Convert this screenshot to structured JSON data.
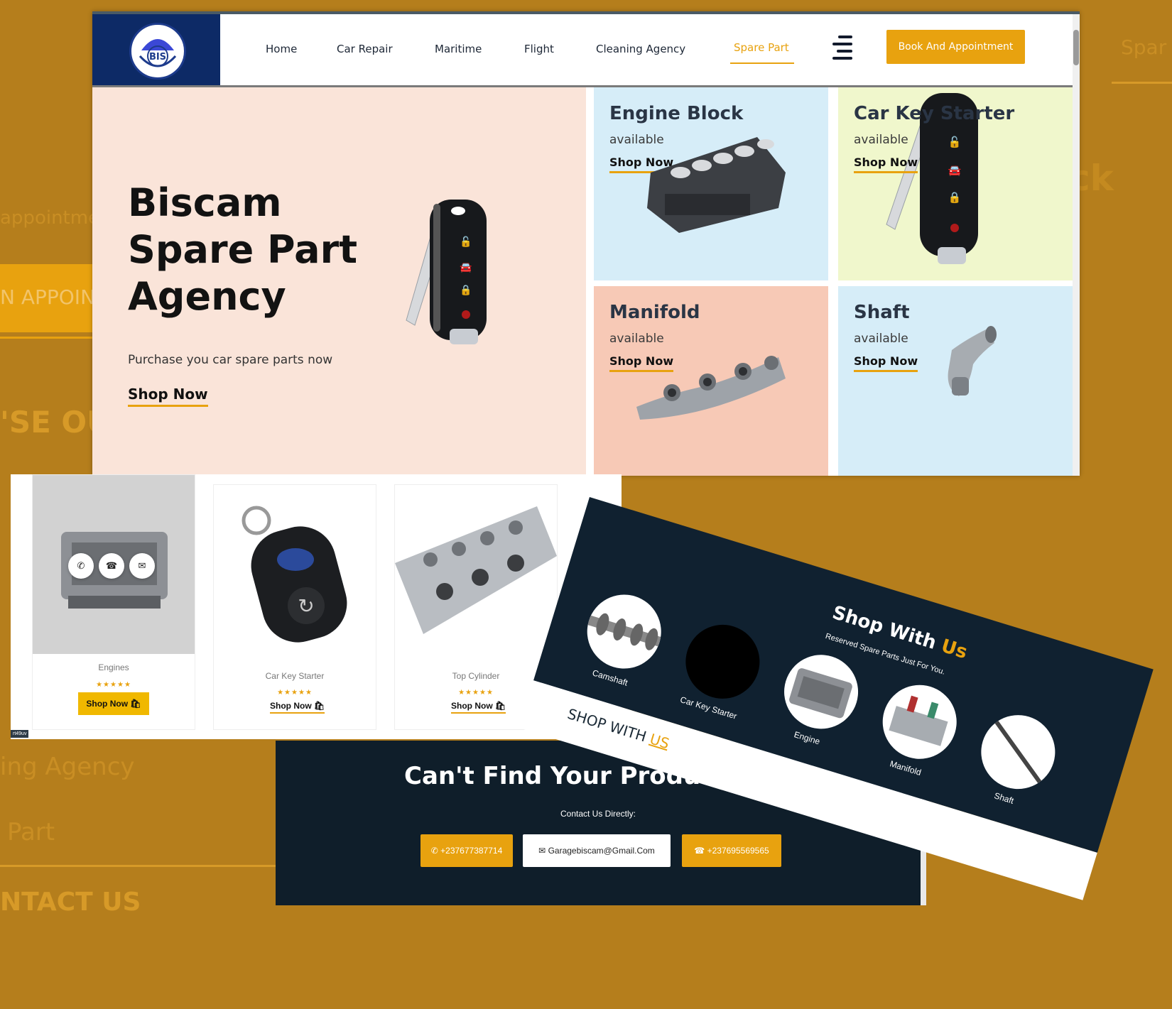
{
  "background_text": {
    "appointment": "appointme",
    "book_appoint": "N APPOINT",
    "choose_our": "'SE OU",
    "cleaning_agency": "ing Agency",
    "spare_part": "Part",
    "contact_us": "NTACT US",
    "right_spare": "Spar",
    "right_ck": "ck"
  },
  "nav": {
    "items": [
      "Home",
      "Car Repair",
      "Maritime",
      "Flight",
      "Cleaning Agency",
      "Spare Part"
    ],
    "active": "Spare Part",
    "book_button": "Book And Appointment",
    "logo_text": "BIS"
  },
  "hero": {
    "title_line1": "Biscam",
    "title_line2": "Spare Part",
    "title_line3": "Agency",
    "subtitle": "Purchase you car spare parts now",
    "cta": "Shop Now"
  },
  "tiles": [
    {
      "title": "Engine Block",
      "status": "available",
      "cta": "Shop Now",
      "bg": "#d6edf8"
    },
    {
      "title": "Car Key Starter",
      "status": "available",
      "cta": "Shop Now",
      "bg": "#f0f7cc"
    },
    {
      "title": "Manifold",
      "status": "available",
      "cta": "Shop Now",
      "bg": "#f7c9b6"
    },
    {
      "title": "Shaft",
      "status": "available",
      "cta": "Shop Now",
      "bg": "#d6edf8"
    }
  ],
  "products": [
    {
      "name": "Engines",
      "rating": "★★★★★",
      "cta": "Shop Now"
    },
    {
      "name": "Car Key Starter",
      "rating": "★★★★★",
      "cta": "Shop Now"
    },
    {
      "name": "Top Cylinder",
      "rating": "★★★★★",
      "cta": "Shop Now"
    }
  ],
  "product_tag": "rt49uv",
  "contact": {
    "title": "Can't Find Your Product Yet?",
    "subtitle": "Contact Us Directly:",
    "whatsapp": "+237677387714",
    "email": "Garagebiscam@Gmail.Com",
    "phone": "+237695569565"
  },
  "shop_with_us": {
    "title_main": "Shop With ",
    "title_accent": "Us",
    "subtitle": "Reserved Spare Parts Just For You.",
    "items": [
      "Camshaft",
      "Car Key Starter",
      "Engine",
      "Manifold",
      "Shaft"
    ],
    "footer_main": "SHOP WITH ",
    "footer_accent": "US"
  },
  "colors": {
    "accent": "#e8a20f",
    "navy": "#0d2a66",
    "dark": "#0f1e2a",
    "background": "#b57e1c"
  }
}
